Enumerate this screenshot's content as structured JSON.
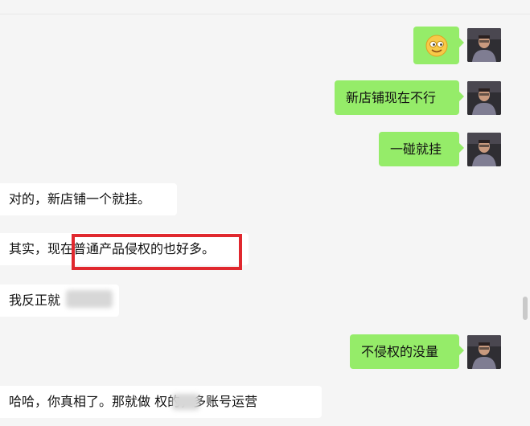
{
  "messages": [
    {
      "side": "out",
      "type": "emoji",
      "emoji_name": "smiling-face-emoji"
    },
    {
      "side": "out",
      "text": "新店铺现在不行"
    },
    {
      "side": "out",
      "text": "一碰就挂"
    },
    {
      "side": "in",
      "text": "对的，新店铺一个就挂。"
    },
    {
      "side": "in",
      "text": "其实，现在普通产品侵权的也好多。"
    },
    {
      "side": "in",
      "text": "我反正就"
    },
    {
      "side": "out",
      "text": "不侵权的没量"
    },
    {
      "side": "in",
      "text": "哈哈，你真相了。那就做   权的，多账号运营"
    }
  ],
  "colors": {
    "outgoing_bubble": "#95ec69",
    "incoming_bubble": "#ffffff",
    "background": "#f5f5f5",
    "highlight_box": "#e0282e"
  },
  "avatar_icon": "user-avatar-photo"
}
